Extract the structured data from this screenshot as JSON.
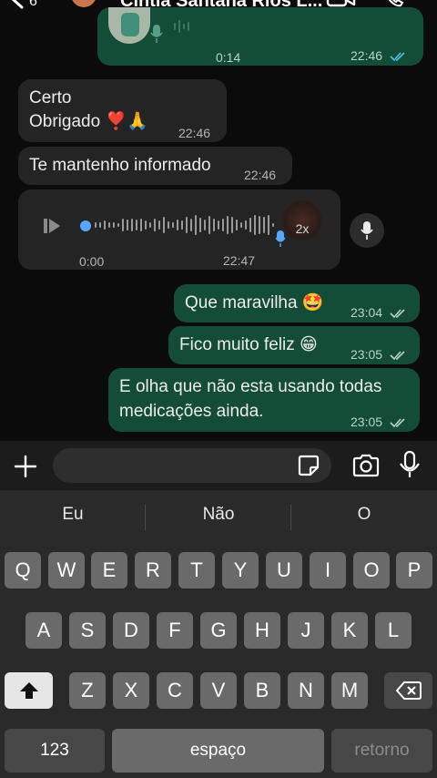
{
  "header": {
    "contact_name": "Cíntia Santana Rios L..."
  },
  "messages": {
    "audio_out": {
      "duration": "0:14",
      "time": "22:46"
    },
    "msg1": {
      "line1": "Certo",
      "line2": "Obrigado ❣️🙏",
      "time": "22:46"
    },
    "msg2": {
      "text": "Te mantenho informado",
      "time": "22:46"
    },
    "audio_in": {
      "position": "0:00",
      "time": "22:47",
      "speed": "2x"
    },
    "msg3": {
      "text": "Que maravilha 🤩",
      "time": "23:04"
    },
    "msg4": {
      "text": "Fico muito feliz 😁",
      "time": "23:05"
    },
    "msg5": {
      "line1": "E olha que não esta usando todas",
      "line2": "medicações ainda.",
      "time": "23:05"
    }
  },
  "input": {
    "placeholder": ""
  },
  "keyboard": {
    "suggestions": [
      "Eu",
      "Não",
      "O"
    ],
    "row1": [
      "Q",
      "W",
      "E",
      "R",
      "T",
      "Y",
      "U",
      "I",
      "O",
      "P"
    ],
    "row2": [
      "A",
      "S",
      "D",
      "F",
      "G",
      "H",
      "J",
      "K",
      "L"
    ],
    "row3": [
      "Z",
      "X",
      "C",
      "V",
      "B",
      "N",
      "M"
    ],
    "numbers_label": "123",
    "space_label": "espaço",
    "return_label": "retorno"
  },
  "colors": {
    "outgoing": "#134d37",
    "incoming": "#242424",
    "read_ticks": "#53bdeb"
  }
}
